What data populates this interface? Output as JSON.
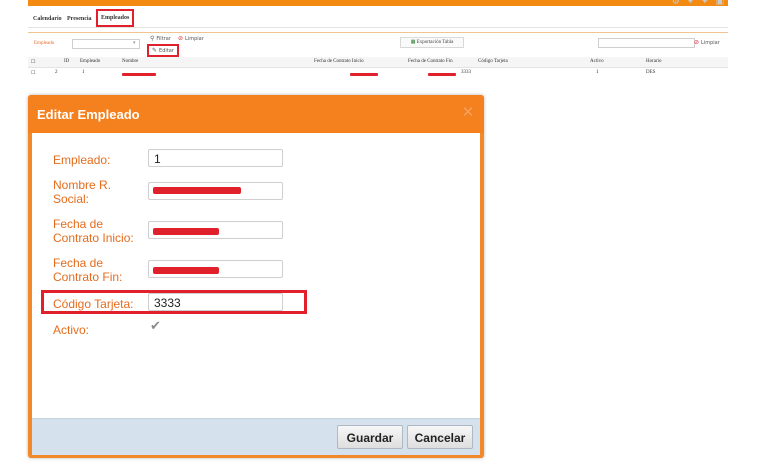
{
  "top_icons": "⚙ ✦ ✦ ▣",
  "tabs": [
    {
      "label": "Calendario"
    },
    {
      "label": "Presencia"
    },
    {
      "label": "Empleados"
    }
  ],
  "toolbar": {
    "empleado_label": "Empleado",
    "filtrar_label": "Filtrar",
    "limpiar_label": "Limpiar",
    "editar_label": "Editar",
    "export_label": "Exportación Tabla",
    "limpiar_right_label": "Limpiar"
  },
  "grid": {
    "headers": [
      "ID",
      "Empleado",
      "Nombre",
      "Fecha de Contrato Inicio",
      "Fecha de Contrato Fin",
      "Código Tarjeta",
      "Activo",
      "Horario"
    ],
    "row": {
      "id": "2",
      "empleado": "1",
      "codigo": "3333",
      "activo": "1",
      "horario": "DES"
    }
  },
  "dialog": {
    "title": "Editar Empleado",
    "fields": {
      "empleado": {
        "label": "Empleado:",
        "value": "1"
      },
      "nombre": {
        "label": "Nombre R. Social:"
      },
      "fecha_inicio": {
        "label": "Fecha de Contrato Inicio:"
      },
      "fecha_fin": {
        "label": "Fecha de Contrato Fin:"
      },
      "codigo": {
        "label": "Código Tarjeta:",
        "value": "3333"
      },
      "activo": {
        "label": "Activo:",
        "checked": true
      }
    },
    "save_label": "Guardar",
    "cancel_label": "Cancelar"
  },
  "colors": {
    "accent": "#f5811e",
    "label": "#e46c1c",
    "highlight": "#e0202a",
    "footer": "#d5e2ee"
  }
}
